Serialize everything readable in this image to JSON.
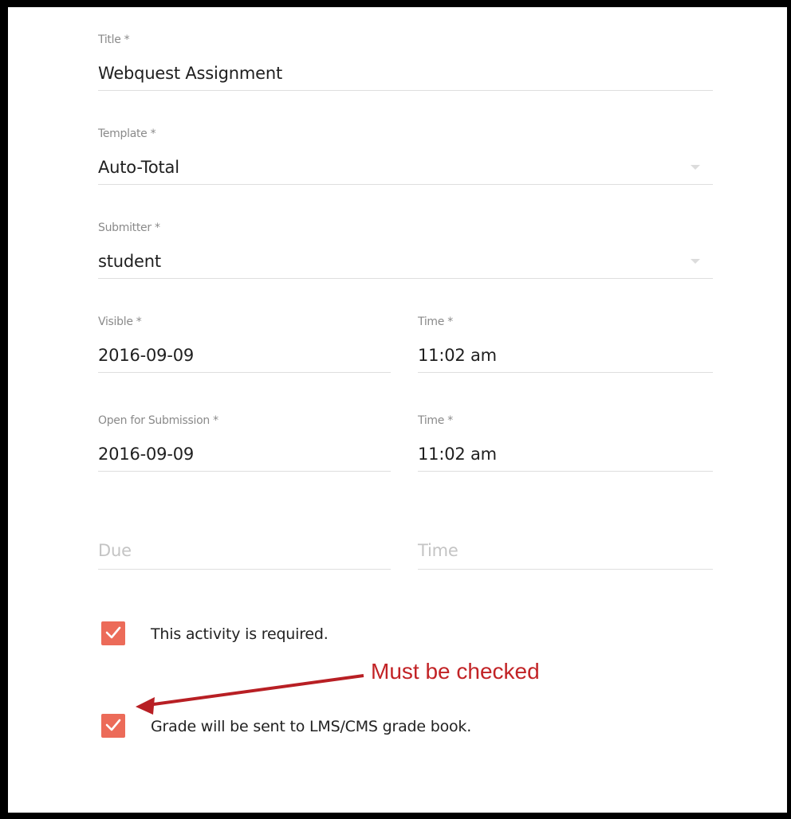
{
  "form": {
    "title": {
      "label": "Title *",
      "value": "Webquest Assignment"
    },
    "template": {
      "label": "Template *",
      "value": "Auto-Total",
      "icon": "chevron-down-icon"
    },
    "submitter": {
      "label": "Submitter *",
      "value": "student",
      "icon": "chevron-down-icon"
    },
    "visible": {
      "date": {
        "label": "Visible *",
        "value": "2016-09-09"
      },
      "time": {
        "label": "Time *",
        "value": "11:02 am"
      }
    },
    "open_for_submission": {
      "date": {
        "label": "Open for Submission *",
        "value": "2016-09-09"
      },
      "time": {
        "label": "Time *",
        "value": "11:02 am"
      }
    },
    "due": {
      "date": {
        "placeholder": "Due"
      },
      "time": {
        "placeholder": "Time"
      }
    },
    "checkboxes": [
      {
        "label": "This activity is required.",
        "checked": true
      },
      {
        "label": "Grade will be sent to LMS/CMS grade book.",
        "checked": true
      }
    ]
  },
  "annotation": {
    "text": "Must be checked",
    "color": "#c22326"
  },
  "colors": {
    "accent": "#ec6b59",
    "underline": "#dedede",
    "label": "#8a8a8a"
  }
}
